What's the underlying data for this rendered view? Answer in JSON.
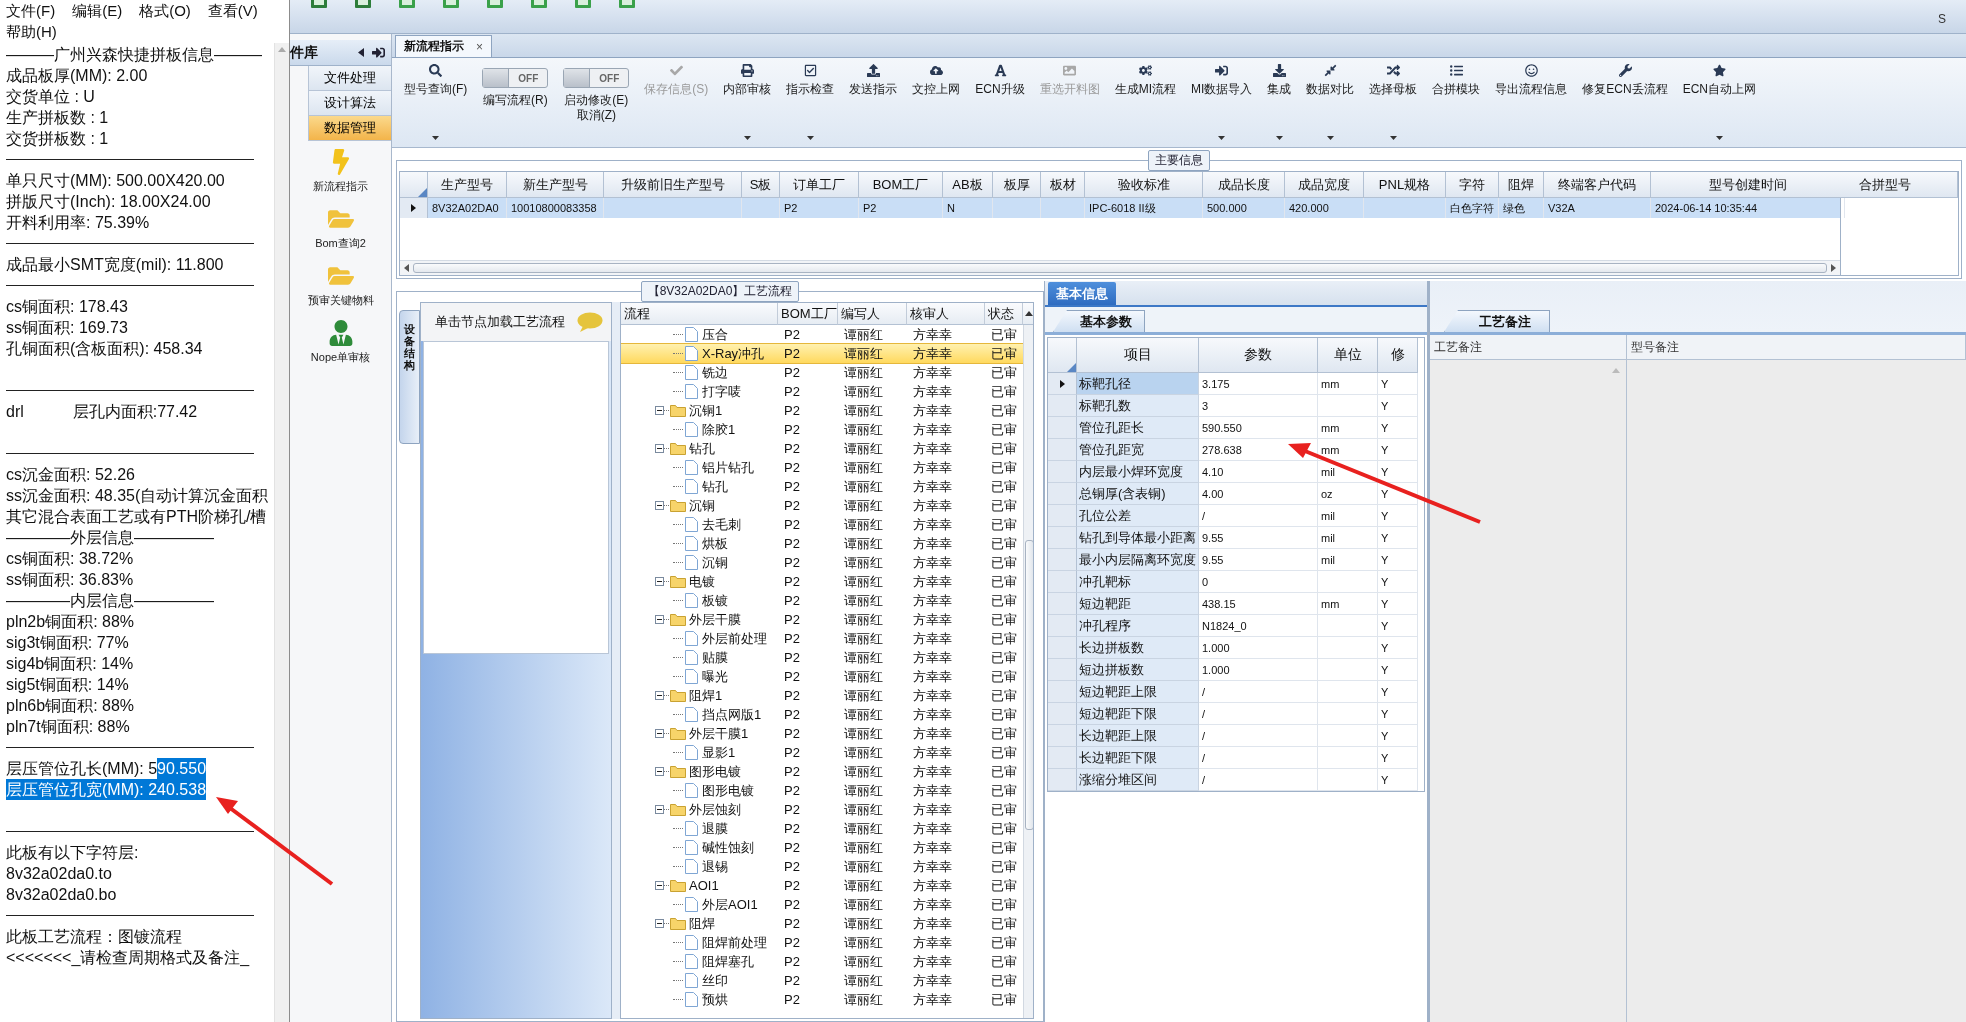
{
  "notepad": {
    "menu": [
      {
        "label": "文件(F)"
      },
      {
        "label": "编辑(E)"
      },
      {
        "label": "格式(O)"
      },
      {
        "label": "查看(V)"
      },
      {
        "label": "帮助(H)"
      }
    ],
    "lines": [
      {
        "kind": "text",
        "text": "———广州兴森快捷拼板信息———"
      },
      {
        "kind": "text",
        "text": "成品板厚(MM): 2.00"
      },
      {
        "kind": "text",
        "text": "交货单位 : U"
      },
      {
        "kind": "text",
        "text": "生产拼板数 : 1"
      },
      {
        "kind": "text",
        "text": "交货拼板数 : 1"
      },
      {
        "kind": "rule"
      },
      {
        "kind": "text",
        "text": "单只尺寸(MM): 500.00X420.00"
      },
      {
        "kind": "text",
        "text": "拼版尺寸(Inch): 18.00X24.00"
      },
      {
        "kind": "text",
        "text": "开料利用率: 75.39%"
      },
      {
        "kind": "rule"
      },
      {
        "kind": "text",
        "text": "成品最小SMT宽度(mil): 11.800"
      },
      {
        "kind": "rule"
      },
      {
        "kind": "text",
        "text": "cs铜面积: 178.43"
      },
      {
        "kind": "text",
        "text": "ss铜面积: 169.73"
      },
      {
        "kind": "text",
        "text": "孔铜面积(含板面积): 458.34"
      },
      {
        "kind": "blank"
      },
      {
        "kind": "rule"
      },
      {
        "kind": "text",
        "text": "drl           层孔内面积:77.42"
      },
      {
        "kind": "blank"
      },
      {
        "kind": "rule"
      },
      {
        "kind": "text",
        "text": "cs沉金面积: 52.26"
      },
      {
        "kind": "text",
        "text": "ss沉金面积: 48.35(自动计算沉金面积"
      },
      {
        "kind": "text",
        "text": "其它混合表面工艺或有PTH阶梯孔/槽"
      },
      {
        "kind": "text",
        "text": "————外层信息—————"
      },
      {
        "kind": "text",
        "text": "cs铜面积: 38.72%"
      },
      {
        "kind": "text",
        "text": "ss铜面积: 36.83%"
      },
      {
        "kind": "text",
        "text": "————内层信息—————"
      },
      {
        "kind": "text",
        "text": "pln2b铜面积: 88%"
      },
      {
        "kind": "text",
        "text": "sig3t铜面积: 77%"
      },
      {
        "kind": "text",
        "text": "sig4b铜面积: 14%"
      },
      {
        "kind": "text",
        "text": "sig5t铜面积: 14%"
      },
      {
        "kind": "text",
        "text": "pln6b铜面积: 88%"
      },
      {
        "kind": "text",
        "text": "pln7t铜面积: 88%"
      },
      {
        "kind": "rule"
      },
      {
        "kind": "text",
        "text": "层压管位孔长(MM): 5",
        "selection": "90.550"
      },
      {
        "kind": "text",
        "selection": "层压管位孔宽(MM): 240.538"
      },
      {
        "kind": "blank"
      },
      {
        "kind": "rule"
      },
      {
        "kind": "text",
        "text": "此板有以下字符层:"
      },
      {
        "kind": "text",
        "text": "8v32a02da0.to"
      },
      {
        "kind": "text",
        "text": "8v32a02da0.bo"
      },
      {
        "kind": "rule"
      },
      {
        "kind": "text",
        "text": "此板工艺流程：图镀流程"
      },
      {
        "kind": "text",
        "text": "<<<<<<<_请检查周期格式及备注_"
      }
    ]
  },
  "top_bar": {
    "status_text": "S"
  },
  "sidebar": {
    "title": "件库",
    "sections": [
      {
        "label": "文件处理",
        "selected": false
      },
      {
        "label": "设计算法",
        "selected": false
      },
      {
        "label": "数据管理",
        "selected": true
      }
    ],
    "tools": [
      {
        "label": "新流程指示"
      },
      {
        "label": "Bom查询2"
      },
      {
        "label": "预审关键物料"
      },
      {
        "label": "Nope单审核"
      }
    ]
  },
  "tabs": [
    {
      "label": "新流程指示",
      "close": "×",
      "selected": true
    }
  ],
  "ribbon": [
    {
      "kind": "button",
      "label": "型号查询(F)",
      "dropdown": true,
      "disabled": false
    },
    {
      "kind": "toggle",
      "label": "编写流程(R)",
      "toggle_text": "OFF",
      "on": false
    },
    {
      "kind": "toggle",
      "label": "启动修改(E)\n取消(Z)",
      "toggle_text": "OFF",
      "on": false
    },
    {
      "kind": "button",
      "label": "保存信息(S)",
      "dropdown": false,
      "disabled": true
    },
    {
      "kind": "button",
      "label": "内部审核",
      "dropdown": true,
      "disabled": false
    },
    {
      "kind": "button",
      "label": "指示检查",
      "dropdown": true,
      "disabled": false
    },
    {
      "kind": "button",
      "label": "发送指示",
      "dropdown": false,
      "disabled": false
    },
    {
      "kind": "button",
      "label": "文控上网",
      "dropdown": false,
      "disabled": false
    },
    {
      "kind": "button",
      "label": "ECN升级",
      "dropdown": false,
      "disabled": false
    },
    {
      "kind": "button",
      "label": "重选开料图",
      "dropdown": false,
      "disabled": true
    },
    {
      "kind": "button",
      "label": "生成MI流程",
      "dropdown": false,
      "disabled": false
    },
    {
      "kind": "button",
      "label": "MI数据导入",
      "dropdown": true,
      "disabled": false
    },
    {
      "kind": "button",
      "label": "集成",
      "dropdown": true,
      "disabled": false
    },
    {
      "kind": "button",
      "label": "数据对比",
      "dropdown": true,
      "disabled": false
    },
    {
      "kind": "button",
      "label": "选择母板",
      "dropdown": true,
      "disabled": false
    },
    {
      "kind": "button",
      "label": "合拼模块",
      "dropdown": false,
      "disabled": false
    },
    {
      "kind": "button",
      "label": "导出流程信息",
      "dropdown": false,
      "disabled": false
    },
    {
      "kind": "button",
      "label": "修复ECN丢流程",
      "dropdown": false,
      "disabled": false
    },
    {
      "kind": "button",
      "label": "ECN自动上网",
      "dropdown": true,
      "disabled": false
    }
  ],
  "main_info": {
    "title": "主要信息",
    "columns": [
      "生产型号",
      "新生产型号",
      "升级前旧生产型号",
      "S板",
      "订单工厂",
      "BOM工厂",
      "AB板",
      "板厚",
      "板材",
      "验收标准",
      "成品长度",
      "成品宽度",
      "PNL规格",
      "字符",
      "阻焊",
      "终端客户代码",
      "型号创建时间"
    ],
    "rows": [
      {
        "selected": true,
        "cells": [
          "8V32A02DA0",
          "10010800083358",
          null,
          null,
          "P2",
          "P2",
          "N",
          null,
          null,
          "IPC-6018 II级",
          "500.000",
          "420.000",
          null,
          "白色字符",
          "绿色",
          "V32A",
          "2024-06-14 10:35:44"
        ]
      }
    ],
    "side_column": "合拼型号"
  },
  "process": {
    "title": "【8V32A02DA0】工艺流程",
    "side_tab": "设备结构",
    "hint": "单击节点加载工艺流程",
    "tree_column": "流程",
    "columns": [
      "BOM工厂",
      "编写人",
      "核审人",
      "状态"
    ],
    "rows": [
      {
        "name": "压合",
        "selected": false,
        "cells": [
          "P2",
          "谭丽红",
          "方幸幸",
          "已审"
        ]
      },
      {
        "name": "X-Ray冲孔",
        "selected": true,
        "cells": [
          "P2",
          "谭丽红",
          "方幸幸",
          "已审"
        ]
      },
      {
        "name": "铣边",
        "selected": false,
        "cells": [
          "P2",
          "谭丽红",
          "方幸幸",
          "已审"
        ]
      },
      {
        "name": "打字唛",
        "selected": false,
        "cells": [
          "P2",
          "谭丽红",
          "方幸幸",
          "已审"
        ]
      },
      {
        "name": "沉铜1",
        "selected": false,
        "expanded": true,
        "cells": [
          "P2",
          "谭丽红",
          "方幸幸",
          "已审"
        ],
        "children": [
          {
            "name": "除胶1",
            "selected": false,
            "cells": [
              "P2",
              "谭丽红",
              "方幸幸",
              "已审"
            ]
          }
        ]
      },
      {
        "name": "钻孔",
        "selected": false,
        "expanded": true,
        "cells": [
          "P2",
          "谭丽红",
          "方幸幸",
          "已审"
        ],
        "children": [
          {
            "name": "铝片钻孔",
            "selected": false,
            "cells": [
              "P2",
              "谭丽红",
              "方幸幸",
              "已审"
            ]
          },
          {
            "name": "钻孔",
            "selected": false,
            "cells": [
              "P2",
              "谭丽红",
              "方幸幸",
              "已审"
            ]
          }
        ]
      },
      {
        "name": "沉铜",
        "selected": false,
        "expanded": true,
        "cells": [
          "P2",
          "谭丽红",
          "方幸幸",
          "已审"
        ],
        "children": [
          {
            "name": "去毛刺",
            "selected": false,
            "cells": [
              "P2",
              "谭丽红",
              "方幸幸",
              "已审"
            ]
          },
          {
            "name": "烘板",
            "selected": false,
            "cells": [
              "P2",
              "谭丽红",
              "方幸幸",
              "已审"
            ]
          },
          {
            "name": "沉铜",
            "selected": false,
            "cells": [
              "P2",
              "谭丽红",
              "方幸幸",
              "已审"
            ]
          }
        ]
      },
      {
        "name": "电镀",
        "selected": false,
        "expanded": true,
        "cells": [
          "P2",
          "谭丽红",
          "方幸幸",
          "已审"
        ],
        "children": [
          {
            "name": "板镀",
            "selected": false,
            "cells": [
              "P2",
              "谭丽红",
              "方幸幸",
              "已审"
            ]
          }
        ]
      },
      {
        "name": "外层干膜",
        "selected": false,
        "expanded": true,
        "cells": [
          "P2",
          "谭丽红",
          "方幸幸",
          "已审"
        ],
        "children": [
          {
            "name": "外层前处理",
            "selected": false,
            "cells": [
              "P2",
              "谭丽红",
              "方幸幸",
              "已审"
            ]
          },
          {
            "name": "贴膜",
            "selected": false,
            "cells": [
              "P2",
              "谭丽红",
              "方幸幸",
              "已审"
            ]
          },
          {
            "name": "曝光",
            "selected": false,
            "cells": [
              "P2",
              "谭丽红",
              "方幸幸",
              "已审"
            ]
          }
        ]
      },
      {
        "name": "阻焊1",
        "selected": false,
        "expanded": true,
        "cells": [
          "P2",
          "谭丽红",
          "方幸幸",
          "已审"
        ],
        "children": [
          {
            "name": "挡点网版1",
            "selected": false,
            "cells": [
              "P2",
              "谭丽红",
              "方幸幸",
              "已审"
            ]
          }
        ]
      },
      {
        "name": "外层干膜1",
        "selected": false,
        "expanded": true,
        "cells": [
          "P2",
          "谭丽红",
          "方幸幸",
          "已审"
        ],
        "children": [
          {
            "name": "显影1",
            "selected": false,
            "cells": [
              "P2",
              "谭丽红",
              "方幸幸",
              "已审"
            ]
          }
        ]
      },
      {
        "name": "图形电镀",
        "selected": false,
        "expanded": true,
        "cells": [
          "P2",
          "谭丽红",
          "方幸幸",
          "已审"
        ],
        "children": [
          {
            "name": "图形电镀",
            "selected": false,
            "cells": [
              "P2",
              "谭丽红",
              "方幸幸",
              "已审"
            ]
          }
        ]
      },
      {
        "name": "外层蚀刻",
        "selected": false,
        "expanded": true,
        "cells": [
          "P2",
          "谭丽红",
          "方幸幸",
          "已审"
        ],
        "children": [
          {
            "name": "退膜",
            "selected": false,
            "cells": [
              "P2",
              "谭丽红",
              "方幸幸",
              "已审"
            ]
          },
          {
            "name": "碱性蚀刻",
            "selected": false,
            "cells": [
              "P2",
              "谭丽红",
              "方幸幸",
              "已审"
            ]
          },
          {
            "name": "退锡",
            "selected": false,
            "cells": [
              "P2",
              "谭丽红",
              "方幸幸",
              "已审"
            ]
          }
        ]
      },
      {
        "name": "AOI1",
        "selected": false,
        "expanded": true,
        "cells": [
          "P2",
          "谭丽红",
          "方幸幸",
          "已审"
        ],
        "children": [
          {
            "name": "外层AOI1",
            "selected": false,
            "cells": [
              "P2",
              "谭丽红",
              "方幸幸",
              "已审"
            ]
          }
        ]
      },
      {
        "name": "阻焊",
        "selected": false,
        "expanded": true,
        "cells": [
          "P2",
          "谭丽红",
          "方幸幸",
          "已审"
        ],
        "children": [
          {
            "name": "阻焊前处理",
            "selected": false,
            "cells": [
              "P2",
              "谭丽红",
              "方幸幸",
              "已审"
            ]
          },
          {
            "name": "阻焊塞孔",
            "selected": false,
            "cells": [
              "P2",
              "谭丽红",
              "方幸幸",
              "已审"
            ]
          },
          {
            "name": "丝印",
            "selected": false,
            "cells": [
              "P2",
              "谭丽红",
              "方幸幸",
              "已审"
            ]
          },
          {
            "name": "预烘",
            "selected": false,
            "cells": [
              "P2",
              "谭丽红",
              "方幸幸",
              "已审"
            ]
          }
        ]
      }
    ]
  },
  "basic_info": {
    "tab": "基本信息",
    "sub_tab": "基本参数",
    "columns": [
      "项目",
      "参数",
      "单位",
      "修"
    ],
    "rows": [
      {
        "selected": true,
        "cells": [
          "标靶孔径",
          "3.175",
          "mm",
          "Y"
        ]
      },
      {
        "selected": false,
        "cells": [
          "标靶孔数",
          "3",
          null,
          "Y"
        ]
      },
      {
        "selected": false,
        "cells": [
          "管位孔距长",
          "590.550",
          "mm",
          "Y"
        ]
      },
      {
        "selected": false,
        "cells": [
          "管位孔距宽",
          "278.638",
          "mm",
          "Y"
        ]
      },
      {
        "selected": false,
        "cells": [
          "内层最小焊环宽度",
          "4.10",
          "mil",
          "Y"
        ]
      },
      {
        "selected": false,
        "cells": [
          "总铜厚(含表铜)",
          "4.00",
          "oz",
          "Y"
        ]
      },
      {
        "selected": false,
        "cells": [
          "孔位公差",
          "/",
          "mil",
          "Y"
        ]
      },
      {
        "selected": false,
        "cells": [
          "钻孔到导体最小距离",
          "9.55",
          "mil",
          "Y"
        ]
      },
      {
        "selected": false,
        "cells": [
          "最小内层隔离环宽度",
          "9.55",
          "mil",
          "Y"
        ]
      },
      {
        "selected": false,
        "cells": [
          "冲孔靶标",
          "0",
          null,
          "Y"
        ]
      },
      {
        "selected": false,
        "cells": [
          "短边靶距",
          "438.15",
          "mm",
          "Y"
        ]
      },
      {
        "selected": false,
        "cells": [
          "冲孔程序",
          "N1824_0",
          null,
          "Y"
        ]
      },
      {
        "selected": false,
        "cells": [
          "长边拼板数",
          "1.000",
          null,
          "Y"
        ]
      },
      {
        "selected": false,
        "cells": [
          "短边拼板数",
          "1.000",
          null,
          "Y"
        ]
      },
      {
        "selected": false,
        "cells": [
          "短边靶距上限",
          "/",
          null,
          "Y"
        ]
      },
      {
        "selected": false,
        "cells": [
          "短边靶距下限",
          "/",
          null,
          "Y"
        ]
      },
      {
        "selected": false,
        "cells": [
          "长边靶距上限",
          "/",
          null,
          "Y"
        ]
      },
      {
        "selected": false,
        "cells": [
          "长边靶距下限",
          "/",
          null,
          "Y"
        ]
      },
      {
        "selected": false,
        "cells": [
          "涨缩分堆区间",
          "/",
          null,
          "Y"
        ]
      }
    ]
  },
  "remarks": {
    "tab": "工艺备注",
    "columns": [
      "工艺备注",
      "型号备注"
    ]
  }
}
